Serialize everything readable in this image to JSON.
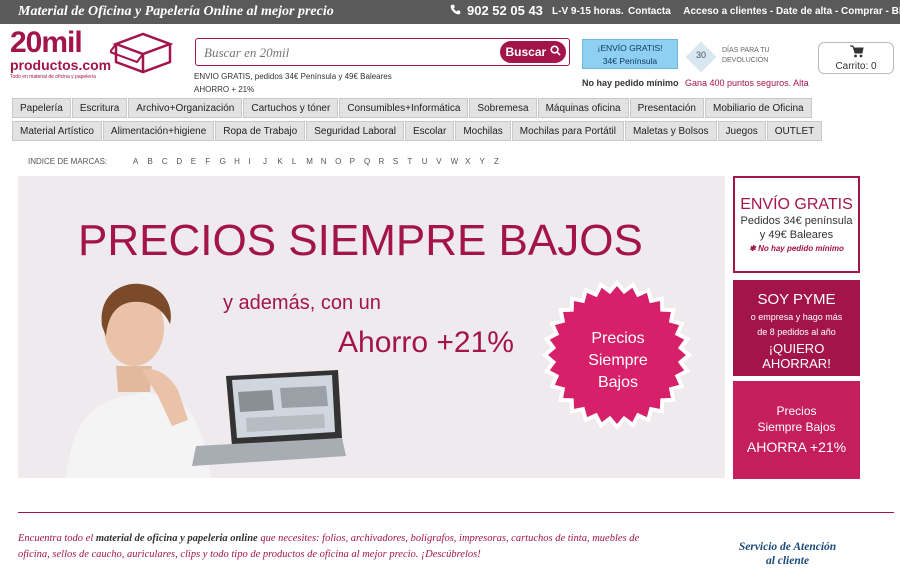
{
  "topbar": {
    "tagline": "Material de Oficina y Papelería Online al mejor precio",
    "phone": "902 52 05 43",
    "hours": "L-V 9-15 horas.",
    "links": [
      "Contacta",
      "Acceso a clientes - Date de alta - Comprar - Blog"
    ]
  },
  "logo": {
    "name": "20mil",
    "domain": "productos.com",
    "slogan": "Todo en material de oficina y papelería"
  },
  "search": {
    "placeholder": "Buscar en 20mil",
    "button": "Buscar"
  },
  "shipping": {
    "line1": "ENVIO GRATIS, pedidos 34€ Península y 49€ Baleares",
    "line2": "AHORRO + 21%"
  },
  "promo": {
    "envio_line1": "¡ENVÍO GRATIS!",
    "envio_line2": "34€ Península",
    "days": "30",
    "days_label_1": "DÍAS PARA TU",
    "days_label_2": "DEVOLUCIÓN",
    "no_min": "No hay pedido mínimo",
    "points": "Gana 400 puntos seguros. Alta"
  },
  "cart": {
    "label": "Carrito: 0"
  },
  "nav_row1": [
    "Papelería",
    "Escritura",
    "Archivo+Organización",
    "Cartuchos y tóner",
    "Consumibles+Informática",
    "Sobremesa",
    "Máquinas oficina",
    "Presentación",
    "Mobiliario de Oficina"
  ],
  "nav_row2": [
    "Material Artístico",
    "Alimentación+higiene",
    "Ropa de Trabajo",
    "Seguridad Laboral",
    "Escolar",
    "Mochilas",
    "Mochilas para Portátil",
    "Maletas y Bolsos",
    "Juegos",
    "OUTLET"
  ],
  "brands": {
    "label": "INDICE DE MARCAS:",
    "letters": [
      "A",
      "B",
      "C",
      "D",
      "E",
      "F",
      "G",
      "H",
      "I",
      "J",
      "K",
      "L",
      "M",
      "N",
      "O",
      "P",
      "Q",
      "R",
      "S",
      "T",
      "U",
      "V",
      "W",
      "X",
      "Y",
      "Z"
    ]
  },
  "hero": {
    "headline": "PRECIOS SIEMPRE BAJOS",
    "sub1": "y además, con un",
    "sub2": "Ahorro +21%",
    "badge_line1": "Precios",
    "badge_line2": "Siempre",
    "badge_line3": "Bajos"
  },
  "side1": {
    "title": "ENVÍO GRATIS",
    "line1": "Pedidos 34€ península",
    "line2": "y 49€ Baleares",
    "note": "✱ No hay pedido mínimo"
  },
  "side2": {
    "title": "SOY PYME",
    "line1": "o empresa y hago más",
    "line2": "de 8 pedidos al año",
    "cta": "¡QUIERO AHORRAR!"
  },
  "side3": {
    "line1": "Precios",
    "line2": "Siempre Bajos",
    "cta": "AHORRA +21%"
  },
  "footer": {
    "part1": "Encuentra todo el ",
    "bold": "material de oficina y papeleria online",
    "part2": " que necesites: folios, archivadores, bolígrafos, impresoras, cartuchos de tinta, muebles de oficina, sellos de caucho, auriculares, clips y todo tipo de productos de oficina al mejor precio. ¡Descúbrelos!",
    "service_line1": "Servicio de Atención",
    "service_line2": "al cliente"
  },
  "colors": {
    "brand": "#a3144a",
    "topbar": "#5a5a5a",
    "nav_bg": "#e2e2e2",
    "sky": "#8fd0f0"
  }
}
